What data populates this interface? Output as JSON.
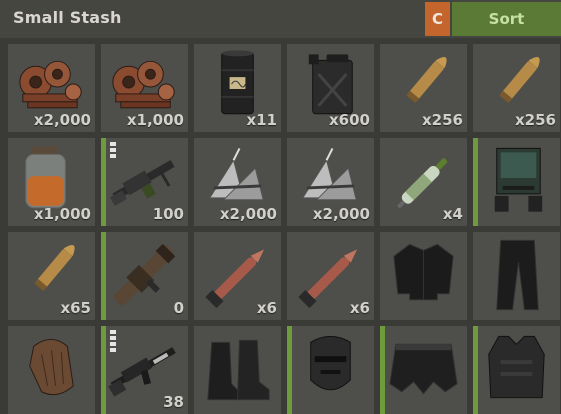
{
  "header": {
    "title": "Small Stash",
    "c_label": "C",
    "sort_label": "Sort"
  },
  "slots": [
    {
      "icon": "gears-icon",
      "qty": "x2,000",
      "bar": false
    },
    {
      "icon": "gears-icon",
      "qty": "x1,000",
      "bar": false
    },
    {
      "icon": "fuel-barrel-icon",
      "qty": "x11",
      "bar": false
    },
    {
      "icon": "jerry-can-icon",
      "qty": "x600",
      "bar": false
    },
    {
      "icon": "rifle-ammo-icon",
      "qty": "x256",
      "bar": false
    },
    {
      "icon": "rifle-ammo-icon",
      "qty": "x256",
      "bar": false
    },
    {
      "icon": "jar-icon",
      "qty": "x1,000",
      "bar": false
    },
    {
      "icon": "light-machine-gun-icon",
      "qty": "100",
      "bar": true,
      "pips": 3
    },
    {
      "icon": "metal-spikes-icon",
      "qty": "x2,000",
      "bar": false
    },
    {
      "icon": "metal-spikes-icon",
      "qty": "x2,000",
      "bar": false
    },
    {
      "icon": "syringe-icon",
      "qty": "x4",
      "bar": false
    },
    {
      "icon": "vending-machine-icon",
      "qty": "",
      "bar": true
    },
    {
      "icon": "rifle-ammo-icon",
      "qty": "x65",
      "bar": false
    },
    {
      "icon": "rocket-launcher-icon",
      "qty": "0",
      "bar": true
    },
    {
      "icon": "rocket-icon",
      "qty": "x6",
      "bar": false
    },
    {
      "icon": "rocket-icon",
      "qty": "x6",
      "bar": false
    },
    {
      "icon": "jacket-icon",
      "qty": "",
      "bar": false
    },
    {
      "icon": "pants-icon",
      "qty": "",
      "bar": false
    },
    {
      "icon": "glove-icon",
      "qty": "",
      "bar": false
    },
    {
      "icon": "assault-rifle-icon",
      "qty": "38",
      "bar": true,
      "pips": 4
    },
    {
      "icon": "boots-icon",
      "qty": "",
      "bar": false
    },
    {
      "icon": "facemask-icon",
      "qty": "",
      "bar": true
    },
    {
      "icon": "kilt-icon",
      "qty": "",
      "bar": true
    },
    {
      "icon": "chest-plate-icon",
      "qty": "",
      "bar": true
    }
  ],
  "colors": {
    "accent_orange": "#c4652e",
    "accent_green": "#5b7a36",
    "condition_bar": "#6e9c3c",
    "slot_bg": "#4e4e4a"
  }
}
